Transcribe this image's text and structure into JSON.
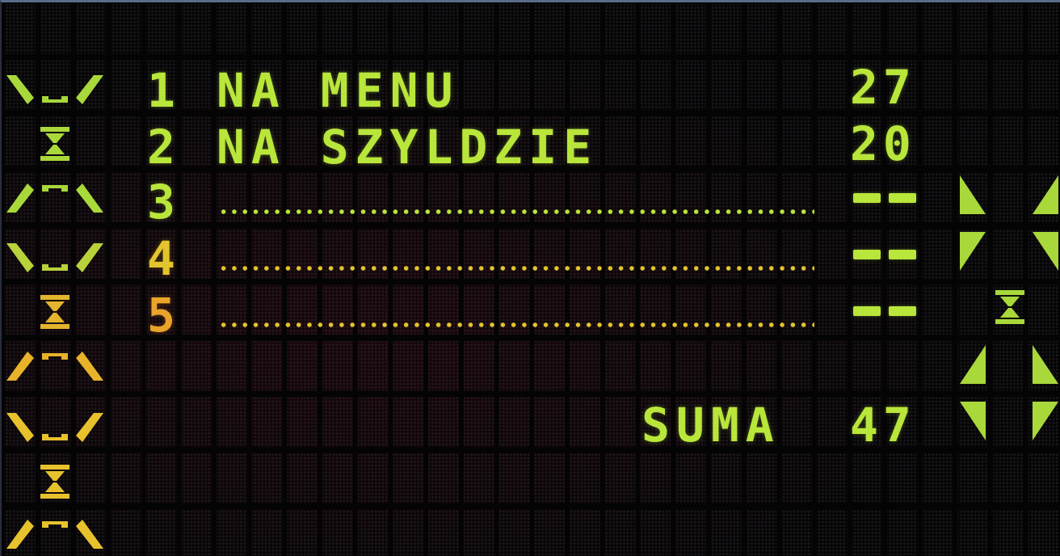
{
  "display": {
    "rows": [
      {
        "number": "1",
        "text": "NA MENU",
        "value": "27",
        "color": "#b9e63a"
      },
      {
        "number": "2",
        "text": "NA SZYLDZIE",
        "value": "20",
        "color": "#b9e63a"
      },
      {
        "number": "3",
        "text": "",
        "value": "",
        "color": "#b9e63a"
      },
      {
        "number": "4",
        "text": "",
        "value": "",
        "color": "#e4c42c"
      },
      {
        "number": "5",
        "text": "",
        "value": "",
        "color": "#eaa42a"
      }
    ],
    "sum": {
      "label": "SUMA",
      "value": "47"
    },
    "colors": {
      "green": "#b9e63a",
      "yellow": "#e4c42c",
      "orange": "#eaa42a",
      "background": "#060506"
    },
    "icons": {
      "left_column": [
        "chevron-frame-bottom-icon",
        "hourglass-icon",
        "chevron-frame-top-icon",
        "chevron-frame-bottom-icon",
        "hourglass-icon",
        "chevron-frame-top-icon",
        "chevron-frame-bottom-icon",
        "hourglass-icon",
        "chevron-frame-top-icon"
      ],
      "right_column": [
        "arrow-corner-icons",
        "hourglass-icon",
        "arrow-corner-icons"
      ]
    }
  }
}
